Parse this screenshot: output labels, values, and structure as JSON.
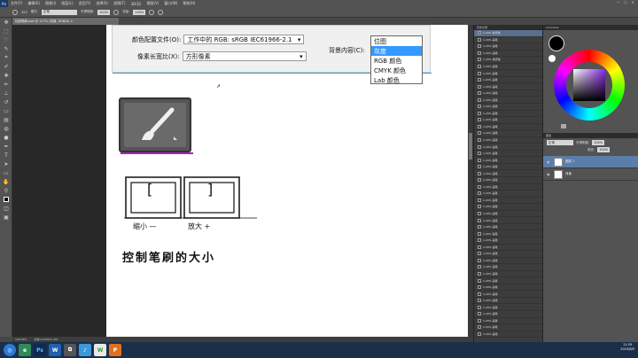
{
  "menubar": {
    "logo": "Ps",
    "items": [
      "文件(F)",
      "编辑(E)",
      "图像(I)",
      "图层(L)",
      "类型(Y)",
      "选择(S)",
      "滤镜(T)",
      "3D(D)",
      "视图(V)",
      "窗口(W)",
      "帮助(H)"
    ],
    "window_controls": [
      "—",
      "▢",
      "✕"
    ]
  },
  "options_bar": {
    "size": "300",
    "mode_label": "模式:",
    "mode_value": "正常",
    "opacity_label": "不透明度:",
    "opacity_value": "100%",
    "flow_label": "流量:",
    "flow_value": "100%"
  },
  "doc_tab": "控制笔刷.psd @ 127% (背景, RGB/8) ×",
  "dialog": {
    "color_profile_label": "颜色配置文件(O):",
    "color_profile_value": "工作中的 RGB: sRGB IEC61966-2.1",
    "aspect_label": "像素长宽比(X):",
    "aspect_value": "方形像素",
    "bg_label": "背景内容(C):",
    "dropdown_items": [
      "位图",
      "灰度",
      "RGB 颜色",
      "CMYK 颜色",
      "Lab 颜色"
    ],
    "dropdown_selected": "灰度"
  },
  "canvas_handwriting": {
    "key_left": "[",
    "key_right": "]",
    "left_note": "缩小 —",
    "right_note": "放大 +",
    "caption": "控制笔刷的大小"
  },
  "status_bar": {
    "zoom": "126.56%",
    "doc_size": "文档:2.67M/11.4M"
  },
  "history_panel": {
    "title": "历史记录",
    "items": [
      "1-20% 橡皮擦",
      "1-20% 画笔",
      "1-20% 画笔",
      "1-20% 画笔",
      "1-20% 橡皮擦",
      "1-20% 画笔",
      "1-20% 画笔",
      "1-20% 画笔",
      "1-20% 画笔",
      "1-20% 画笔",
      "1-20% 画笔",
      "1-20% 画笔",
      "1-20% 画笔",
      "1-20% 画笔",
      "1-20% 画笔",
      "1-20% 画笔",
      "1-20% 画笔",
      "1-20% 画笔",
      "1-20% 画笔",
      "1-20% 画笔",
      "1-20% 画笔",
      "1-20% 画笔",
      "1-20% 画笔",
      "1-20% 画笔",
      "1-20% 画笔",
      "1-20% 画笔",
      "1-20% 画笔",
      "1-20% 画笔",
      "1-20% 画笔",
      "1-20% 画笔",
      "1-20% 画笔",
      "1-20% 画笔",
      "1-20% 画笔",
      "1-20% 画笔",
      "1-20% 画笔",
      "1-20% 画笔",
      "1-20% 画笔",
      "1-20% 画笔",
      "1-20% 画笔",
      "1-20% 画笔",
      "1-20% 画笔",
      "1-20% 画笔",
      "1-20% 画笔",
      "1-20% 画笔",
      "1-20% 画笔",
      "1-20% 画笔"
    ]
  },
  "color_panel": {
    "title": "Colorwise"
  },
  "layers_panel": {
    "blend_mode": "正常",
    "opacity_label": "不透明度:",
    "opacity_value": "100%",
    "fill_label": "填充:",
    "fill_value": "100%",
    "layers": [
      {
        "name": "图层 1",
        "selected": true
      },
      {
        "name": "背景",
        "selected": false
      }
    ]
  },
  "taskbar": {
    "apps": [
      "◎",
      "e",
      "Ps",
      "W",
      "⧉",
      "♪",
      "W",
      "P"
    ],
    "time": "11:29",
    "date": "2015/8/5"
  },
  "colors": {
    "accent": "#3399ff",
    "panel": "#535353",
    "canvas": "#ffffff"
  }
}
